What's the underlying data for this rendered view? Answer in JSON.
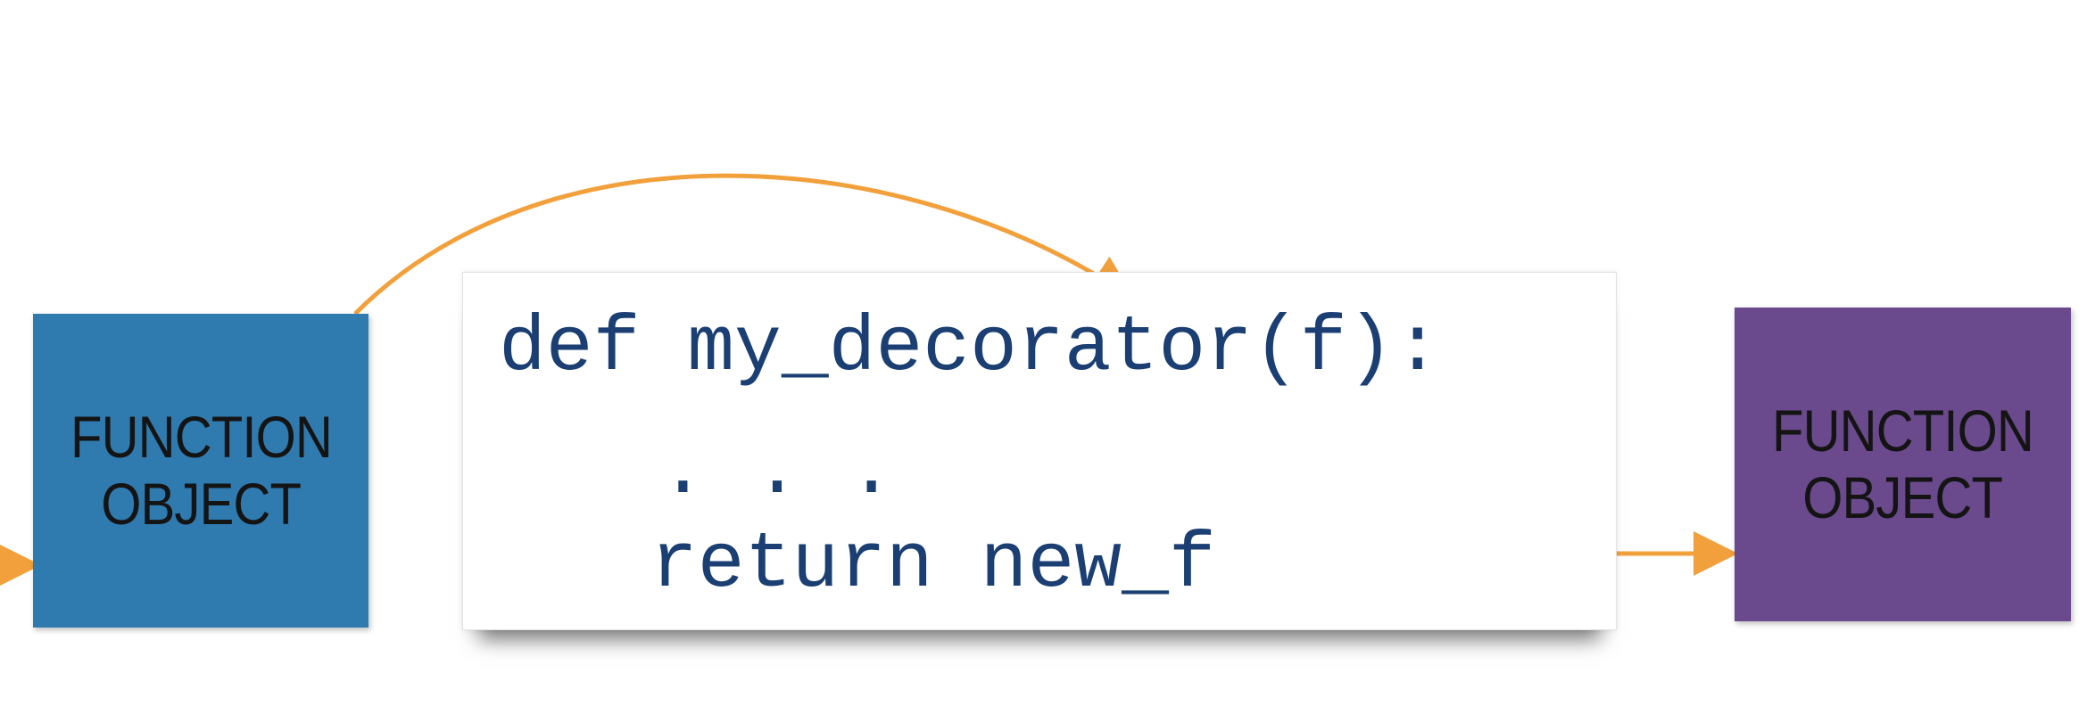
{
  "left_box": {
    "line1": "FUNCTION",
    "line2": "OBJECT",
    "color": "#2f7bb0"
  },
  "right_box": {
    "line1": "FUNCTION",
    "line2": "OBJECT",
    "color": "#6a4a8c"
  },
  "code": {
    "line1": "def my_decorator(f):",
    "line2": ". . .",
    "line3": "return new_f",
    "color": "#1b3f73"
  },
  "arrow_color": "#f2a03c"
}
